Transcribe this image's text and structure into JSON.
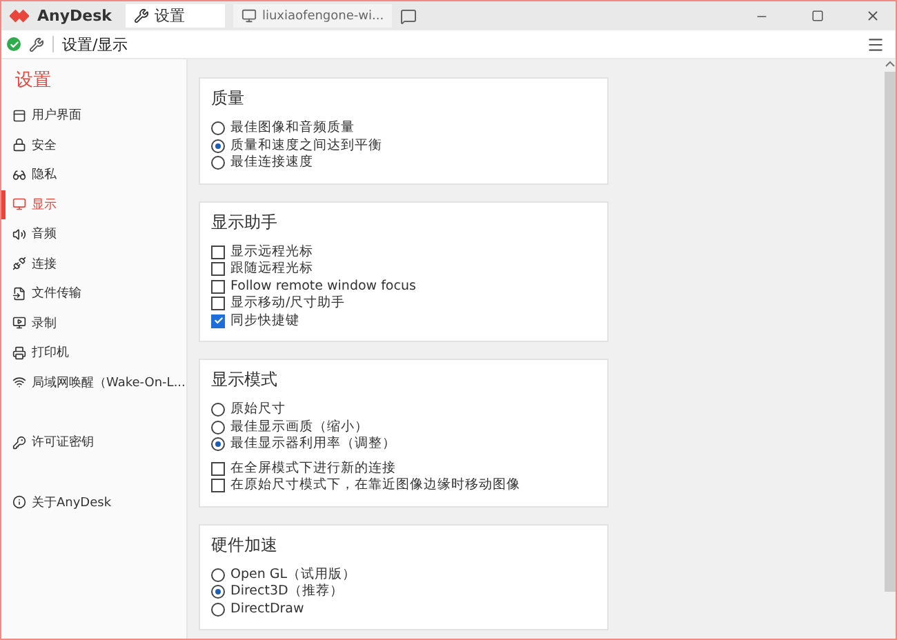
{
  "window": {
    "app_name": "AnyDesk"
  },
  "tabs": [
    {
      "label": "设置",
      "kind": "settings",
      "selected": true
    },
    {
      "label": "liuxiaofengone-wi...",
      "kind": "remote",
      "selected": false
    }
  ],
  "address": {
    "connected": true,
    "path": "设置/显示"
  },
  "sidebar": {
    "title": "设置",
    "groups": [
      [
        {
          "label": "用户界面",
          "kind": "ui",
          "selected": false
        },
        {
          "label": "安全",
          "kind": "security",
          "selected": false
        },
        {
          "label": "隐私",
          "kind": "privacy",
          "selected": false
        },
        {
          "label": "显示",
          "kind": "display",
          "selected": true
        },
        {
          "label": "音频",
          "kind": "audio",
          "selected": false
        },
        {
          "label": "连接",
          "kind": "connection",
          "selected": false
        },
        {
          "label": "文件传输",
          "kind": "file",
          "selected": false
        },
        {
          "label": "录制",
          "kind": "recording",
          "selected": false
        },
        {
          "label": "打印机",
          "kind": "printer",
          "selected": false
        },
        {
          "label": "局域网唤醒（Wake-On-L...",
          "kind": "wake",
          "selected": false
        }
      ],
      [
        {
          "label": "许可证密钥",
          "kind": "license",
          "selected": false
        }
      ],
      [
        {
          "label": "关于AnyDesk",
          "kind": "about",
          "selected": false
        }
      ]
    ]
  },
  "sections": [
    {
      "title": "质量",
      "groups": [
        {
          "kind": "radio",
          "items": [
            {
              "label": "最佳图像和音频质量",
              "selected": false
            },
            {
              "label": "质量和速度之间达到平衡",
              "selected": true
            },
            {
              "label": "最佳连接速度",
              "selected": false
            }
          ]
        }
      ]
    },
    {
      "title": "显示助手",
      "groups": [
        {
          "kind": "checkbox",
          "items": [
            {
              "label": "显示远程光标",
              "checked": false
            },
            {
              "label": "跟随远程光标",
              "checked": false
            },
            {
              "label": "Follow remote window focus",
              "checked": false
            },
            {
              "label": "显示移动/尺寸助手",
              "checked": false
            },
            {
              "label": "同步快捷键",
              "checked": true
            }
          ]
        }
      ]
    },
    {
      "title": "显示模式",
      "groups": [
        {
          "kind": "radio",
          "items": [
            {
              "label": "原始尺寸",
              "selected": false
            },
            {
              "label": "最佳显示画质（缩小）",
              "selected": false
            },
            {
              "label": "最佳显示器利用率（调整）",
              "selected": true
            }
          ]
        },
        {
          "kind": "checkbox",
          "items": [
            {
              "label": "在全屏模式下进行新的连接",
              "checked": false
            },
            {
              "label": "在原始尺寸模式下，在靠近图像边缘时移动图像",
              "checked": false
            }
          ]
        }
      ]
    },
    {
      "title": "硬件加速",
      "groups": [
        {
          "kind": "radio",
          "items": [
            {
              "label": "Open GL（试用版）",
              "selected": false
            },
            {
              "label": "Direct3D（推荐）",
              "selected": true
            },
            {
              "label": "DirectDraw",
              "selected": false
            }
          ]
        }
      ]
    }
  ]
}
